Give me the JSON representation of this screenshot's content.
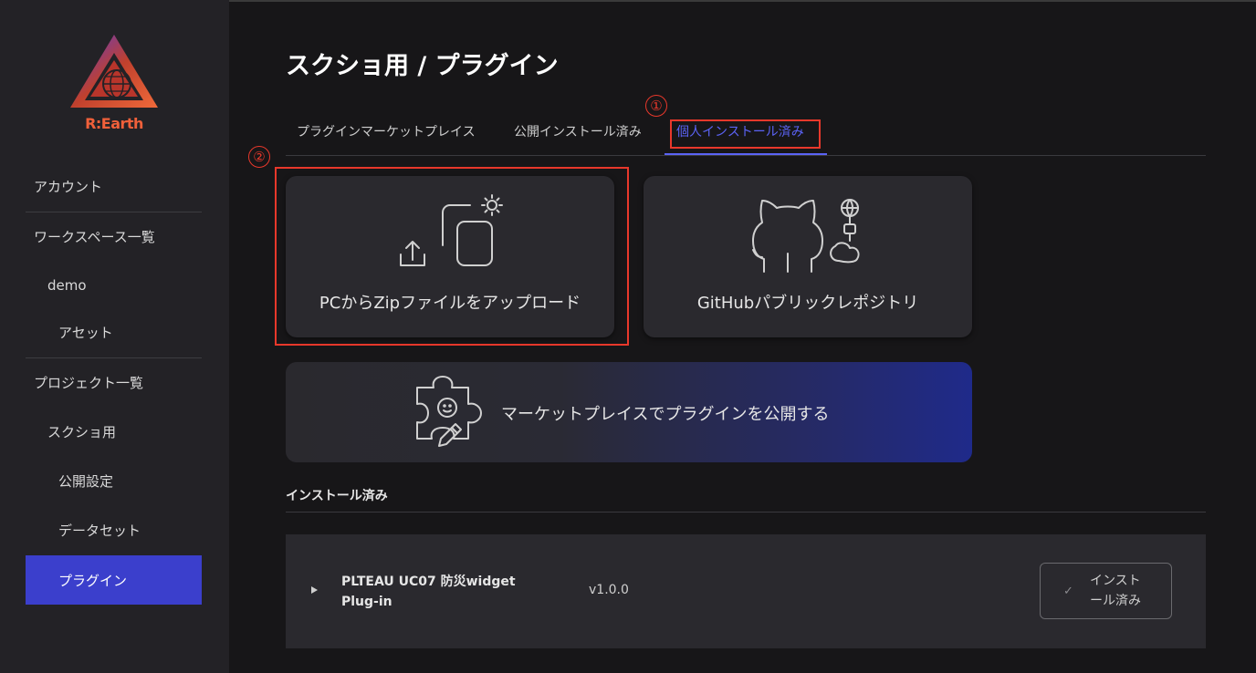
{
  "brand": {
    "logo_text": "R:Earth",
    "accent": "#3b3fcc",
    "logo_color": "#f0603a"
  },
  "sidebar": {
    "items": [
      {
        "label": "アカウント"
      },
      {
        "label": "ワークスペース一覧"
      },
      {
        "label": "demo"
      },
      {
        "label": "アセット"
      },
      {
        "label": "プロジェクト一覧"
      },
      {
        "label": "スクショ用"
      },
      {
        "label": "公開設定"
      },
      {
        "label": "データセット"
      },
      {
        "label": "プラグイン"
      }
    ],
    "active_index": 8
  },
  "header": {
    "title": "スクショ用 / プラグイン"
  },
  "tabs": [
    {
      "label": "プラグインマーケットプレイス"
    },
    {
      "label": "公開インストール済み"
    },
    {
      "label": "個人インストール済み"
    }
  ],
  "annotations": {
    "one": "①",
    "two": "②",
    "color": "#e8382b"
  },
  "cards": {
    "zip": {
      "label": "PCからZipファイルをアップロード",
      "icon": "upload-zip-icon"
    },
    "github": {
      "label": "GitHubパブリックレポジトリ",
      "icon": "github-icon"
    },
    "publish": {
      "label": "マーケットプレイスでプラグインを公開する",
      "icon": "puzzle-icon"
    }
  },
  "installed": {
    "section_title": "インストール済み",
    "plugins": [
      {
        "name": "PLTEAU UC07 防災widget Plug-in",
        "version": "v1.0.0",
        "status_label": "インストール済み"
      }
    ]
  }
}
